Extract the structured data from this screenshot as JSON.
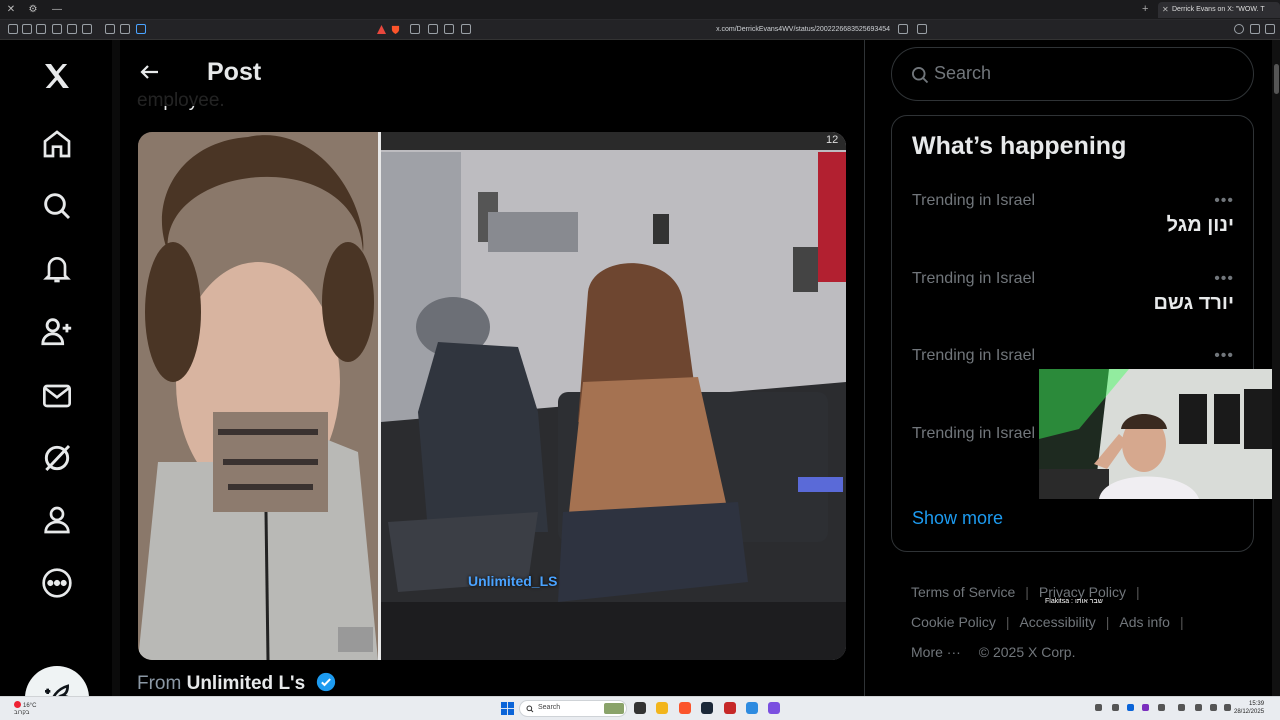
{
  "browser": {
    "tab_title": "Derrick Evans on X: \"WOW. T",
    "url": "x.com/DerrickEvans4WV/status/2002226683525693454"
  },
  "post": {
    "header_title": "Post",
    "cut_text": "employee.",
    "media_watermark": "Unlimited_LS",
    "media_counter": "12",
    "from_label": "From",
    "from_account": "Unlimited L's"
  },
  "search": {
    "placeholder": "Search"
  },
  "whats_happening": {
    "title": "What’s happening",
    "trends": [
      {
        "meta": "Trending in Israel",
        "name": "ינון מגל",
        "more": "•••"
      },
      {
        "meta": "Trending in Israel",
        "name": "יורד גשם",
        "more": "•••"
      },
      {
        "meta": "Trending in Israel",
        "name": "",
        "more": "•••"
      },
      {
        "meta": "Trending in Israel",
        "name": "",
        "more": ""
      }
    ],
    "show_more": "Show more"
  },
  "footer": {
    "terms": "Terms of Service",
    "privacy": "Privacy Policy",
    "cookie": "Cookie Policy",
    "accessibility": "Accessibility",
    "ads": "Ads info",
    "more": "More ···",
    "copyright": "© 2025 X Corp."
  },
  "stream_overlay": {
    "text": "Flakitsa : שבר אותו"
  },
  "taskbar": {
    "weather_temp": "16°C",
    "weather_desc": "בקרוב",
    "search_placeholder": "Search",
    "time": "15:39",
    "date": "28/12/2025"
  },
  "icons": {
    "nav": [
      "x-logo-icon",
      "home-icon",
      "explore-icon",
      "notifications-icon",
      "communities-icon",
      "messages-icon",
      "grok-icon",
      "profile-icon",
      "more-icon"
    ],
    "compose": "compose-icon"
  },
  "colors": {
    "accent": "#1d9bf0",
    "background": "#000000",
    "border": "#2f3336",
    "muted": "#71767b"
  }
}
